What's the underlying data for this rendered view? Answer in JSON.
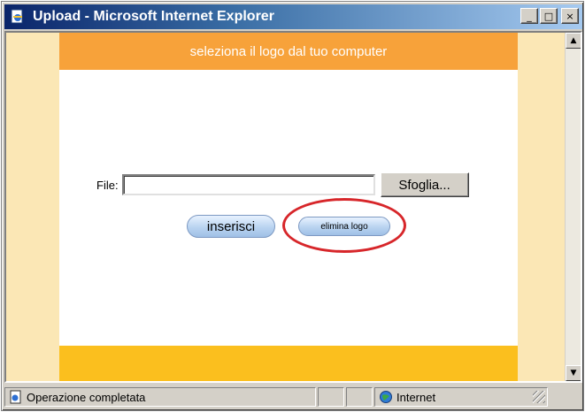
{
  "window": {
    "title": "Upload - Microsoft Internet Explorer",
    "buttons": {
      "minimize": "_",
      "maximize": "□",
      "close": "×"
    }
  },
  "page": {
    "header_text": "seleziona il logo dal tuo computer",
    "file_label": "File:",
    "file_value": "",
    "browse_label": "Sfoglia...",
    "insert_label": "inserisci",
    "delete_label": "elimina logo"
  },
  "statusbar": {
    "status_text": "Operazione completata",
    "zone_text": "Internet"
  },
  "colors": {
    "header_band": "#f7a23a",
    "footer_band": "#fbbf1e",
    "side_background": "#fbe7b5",
    "highlight_ring": "#d7262a",
    "titlebar_start": "#0a246a"
  },
  "icons": [
    "ie-page-icon",
    "minimize-icon",
    "maximize-icon",
    "close-icon",
    "scroll-up-icon",
    "scroll-down-icon",
    "done-page-icon",
    "globe-icon"
  ]
}
